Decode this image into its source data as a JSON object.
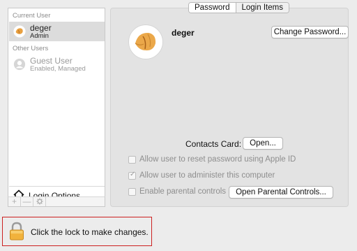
{
  "sidebar": {
    "current_user_label": "Current User",
    "current_user": {
      "name": "deger",
      "role": "Admin"
    },
    "other_users_label": "Other Users",
    "guest_user": {
      "name": "Guest User",
      "status": "Enabled, Managed"
    },
    "login_options_label": "Login Options",
    "toolbar": {
      "add": "+",
      "remove": "—",
      "gear_icon": "gear-icon"
    }
  },
  "tabs": [
    {
      "label": "Password",
      "active": false
    },
    {
      "label": "Login Items",
      "active": true
    }
  ],
  "main": {
    "username": "deger",
    "change_password_label": "Change Password...",
    "contacts_card_label": "Contacts Card:",
    "open_label": "Open...",
    "checkboxes": [
      {
        "label": "Allow user to reset password using Apple ID",
        "checked": false
      },
      {
        "label": "Allow user to administer this computer",
        "checked": true
      },
      {
        "label": "Enable parental controls",
        "checked": false
      }
    ],
    "open_parental_controls_label": "Open Parental Controls..."
  },
  "lock": {
    "text": "Click the lock to make changes.",
    "icon": "lock-icon"
  },
  "colors": {
    "lock_border": "#cc2020",
    "selected_row": "#dcdcdc",
    "panel_bg": "#e3e3e3"
  }
}
